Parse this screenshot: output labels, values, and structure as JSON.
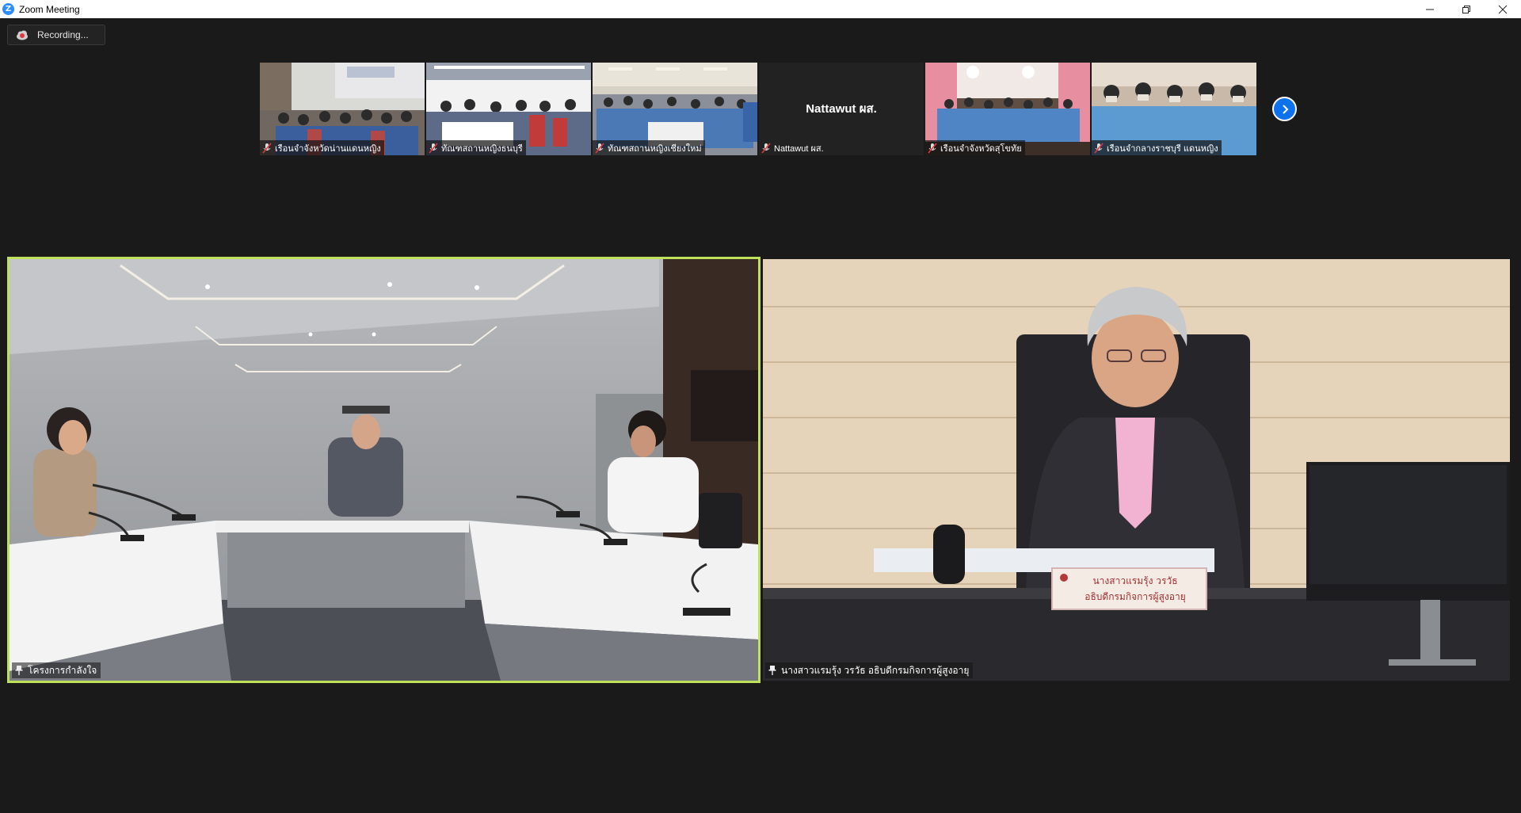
{
  "window": {
    "title": "Zoom Meeting",
    "logo_letter": "Z"
  },
  "recording": {
    "label": "Recording..."
  },
  "thumbnails": [
    {
      "name": "เรือนจำจังหวัดน่านแดนหญิง",
      "muted": true,
      "video": true
    },
    {
      "name": "ทัณฑสถานหญิงธนบุรี",
      "muted": true,
      "video": true
    },
    {
      "name": "ทัณฑสถานหญิงเชียงใหม่",
      "muted": true,
      "video": true
    },
    {
      "name": "Nattawut ผส.",
      "muted": true,
      "video": false,
      "center_name": "Nattawut ผส."
    },
    {
      "name": "เรือนจำจังหวัดสุโขทัย",
      "muted": true,
      "video": true
    },
    {
      "name": "เรือนจำกลางราชบุรี แดนหญิง",
      "muted": true,
      "video": true
    }
  ],
  "main_tiles": {
    "left": {
      "name": "โครงการกำลังใจ",
      "pinned": true,
      "active_speaker": true
    },
    "right": {
      "name": "นางสาวแรมรุ้ง วรวัธ อธิบดีกรมกิจการผู้สูงอายุ",
      "pinned": true,
      "nameplate_line1": "นางสาวแรมรุ้ง วรวัธ",
      "nameplate_line2": "อธิบดีกรมกิจการผู้สูงอายุ"
    }
  },
  "colors": {
    "active_speaker_border": "#bfe05a",
    "accent_blue": "#0e72ed"
  }
}
